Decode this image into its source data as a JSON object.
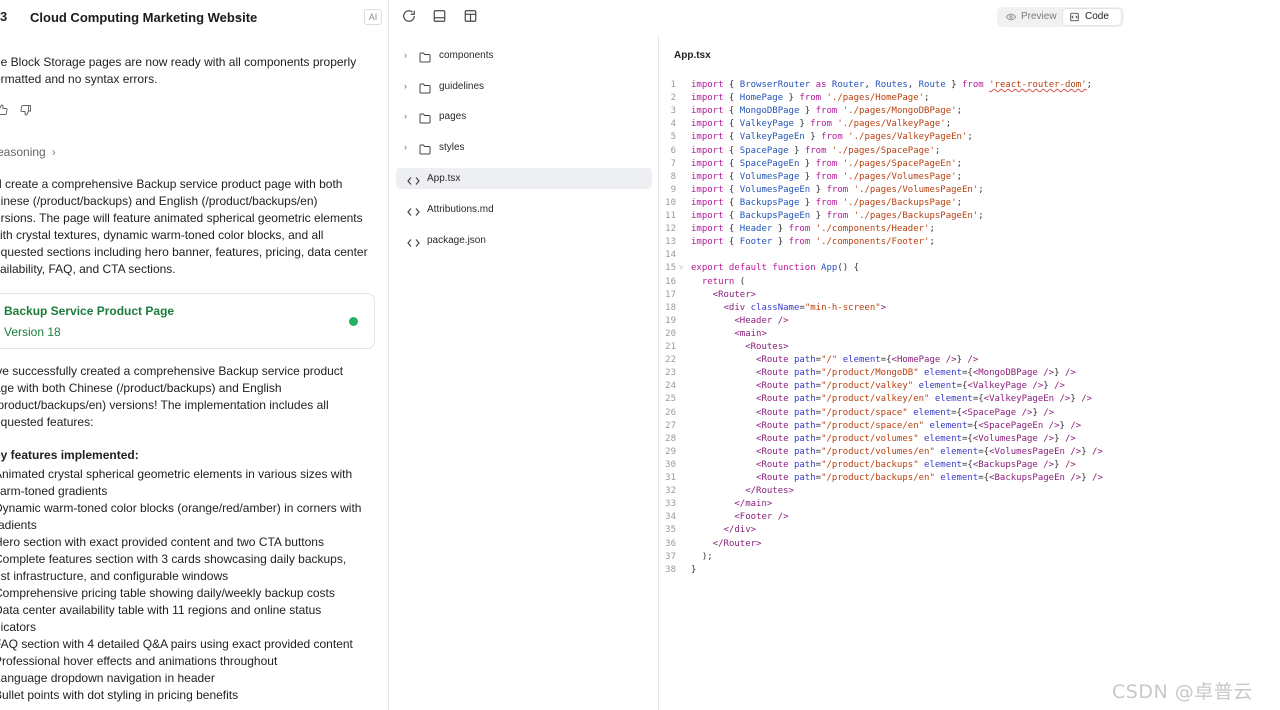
{
  "chat": {
    "logo_fragment": "3",
    "project_title": "Cloud Computing Marketing Website",
    "ai_badge": "AI",
    "intro_lines": [
      "he Block Storage pages are now ready with all components properly",
      "ormatted and no syntax errors."
    ],
    "reasoning_label": "easoning",
    "plan_lines": [
      "'ll create a comprehensive Backup service product page with both",
      "hinese (/product/backups) and English (/product/backups/en)",
      "ersions. The page will feature animated spherical geometric elements",
      "vith crystal textures, dynamic warm-toned color blocks, and all",
      "equested sections including hero banner, features, pricing, data center",
      "vailability, FAQ, and CTA sections."
    ],
    "version_card": {
      "title": "Backup Service Product Page",
      "version": "Version 18"
    },
    "summary_lines": [
      "'ve successfully created a comprehensive Backup service product",
      "age with both Chinese (/product/backups) and English",
      "/product/backups/en) versions! The implementation includes all",
      "equested features:"
    ],
    "key_features_heading": "ey features implemented:",
    "feature_lines": [
      " Animated crystal spherical geometric elements in various sizes with",
      "varm-toned gradients",
      " Dynamic warm-toned color blocks (orange/red/amber) in corners with",
      "radients",
      " Hero section with exact provided content and two CTA buttons",
      " Complete features section with 3 cards showcasing daily backups,",
      "ust infrastructure, and configurable windows",
      " Comprehensive pricing table showing daily/weekly backup costs",
      " Data center availability table with 11 regions and online status",
      "dicators",
      " FAQ section with 4 detailed Q&A pairs using exact provided content",
      " Professional hover effects and animations throughout",
      " Language dropdown navigation in header",
      " Bullet points with dot styling in pricing benefits"
    ]
  },
  "toolbar": {
    "preview_label": "Preview",
    "code_label": "Code",
    "active_view": "Code"
  },
  "file_tree": [
    {
      "type": "folder",
      "name": "components"
    },
    {
      "type": "folder",
      "name": "guidelines"
    },
    {
      "type": "folder",
      "name": "pages"
    },
    {
      "type": "folder",
      "name": "styles"
    },
    {
      "type": "file",
      "name": "App.tsx",
      "selected": true
    },
    {
      "type": "file",
      "name": "Attributions.md"
    },
    {
      "type": "file",
      "name": "package.json"
    }
  ],
  "editor": {
    "filename": "App.tsx",
    "lines": [
      [
        [
          "kw",
          "import"
        ],
        [
          "pl",
          " { "
        ],
        [
          "id",
          "BrowserRouter"
        ],
        [
          "kw",
          " as "
        ],
        [
          "id",
          "Router"
        ],
        [
          "pl",
          ", "
        ],
        [
          "id",
          "Routes"
        ],
        [
          "pl",
          ", "
        ],
        [
          "id",
          "Route"
        ],
        [
          "pl",
          " } "
        ],
        [
          "kw",
          "from"
        ],
        [
          "pl",
          " "
        ],
        [
          "stw",
          "'react-router-dom'"
        ],
        [
          "pl",
          ";"
        ]
      ],
      [
        [
          "kw",
          "import"
        ],
        [
          "pl",
          " { "
        ],
        [
          "id",
          "HomePage"
        ],
        [
          "pl",
          " } "
        ],
        [
          "kw",
          "from"
        ],
        [
          "st",
          " './pages/HomePage'"
        ],
        [
          "pl",
          ";"
        ]
      ],
      [
        [
          "kw",
          "import"
        ],
        [
          "pl",
          " { "
        ],
        [
          "id",
          "MongoDBPage"
        ],
        [
          "pl",
          " } "
        ],
        [
          "kw",
          "from"
        ],
        [
          "st",
          " './pages/MongoDBPage'"
        ],
        [
          "pl",
          ";"
        ]
      ],
      [
        [
          "kw",
          "import"
        ],
        [
          "pl",
          " { "
        ],
        [
          "id",
          "ValkeyPage"
        ],
        [
          "pl",
          " } "
        ],
        [
          "kw",
          "from"
        ],
        [
          "st",
          " './pages/ValkeyPage'"
        ],
        [
          "pl",
          ";"
        ]
      ],
      [
        [
          "kw",
          "import"
        ],
        [
          "pl",
          " { "
        ],
        [
          "id",
          "ValkeyPageEn"
        ],
        [
          "pl",
          " } "
        ],
        [
          "kw",
          "from"
        ],
        [
          "st",
          " './pages/ValkeyPageEn'"
        ],
        [
          "pl",
          ";"
        ]
      ],
      [
        [
          "kw",
          "import"
        ],
        [
          "pl",
          " { "
        ],
        [
          "id",
          "SpacePage"
        ],
        [
          "pl",
          " } "
        ],
        [
          "kw",
          "from"
        ],
        [
          "st",
          " './pages/SpacePage'"
        ],
        [
          "pl",
          ";"
        ]
      ],
      [
        [
          "kw",
          "import"
        ],
        [
          "pl",
          " { "
        ],
        [
          "id",
          "SpacePageEn"
        ],
        [
          "pl",
          " } "
        ],
        [
          "kw",
          "from"
        ],
        [
          "st",
          " './pages/SpacePageEn'"
        ],
        [
          "pl",
          ";"
        ]
      ],
      [
        [
          "kw",
          "import"
        ],
        [
          "pl",
          " { "
        ],
        [
          "id",
          "VolumesPage"
        ],
        [
          "pl",
          " } "
        ],
        [
          "kw",
          "from"
        ],
        [
          "st",
          " './pages/VolumesPage'"
        ],
        [
          "pl",
          ";"
        ]
      ],
      [
        [
          "kw",
          "import"
        ],
        [
          "pl",
          " { "
        ],
        [
          "id",
          "VolumesPageEn"
        ],
        [
          "pl",
          " } "
        ],
        [
          "kw",
          "from"
        ],
        [
          "st",
          " './pages/VolumesPageEn'"
        ],
        [
          "pl",
          ";"
        ]
      ],
      [
        [
          "kw",
          "import"
        ],
        [
          "pl",
          " { "
        ],
        [
          "id",
          "BackupsPage"
        ],
        [
          "pl",
          " } "
        ],
        [
          "kw",
          "from"
        ],
        [
          "st",
          " './pages/BackupsPage'"
        ],
        [
          "pl",
          ";"
        ]
      ],
      [
        [
          "kw",
          "import"
        ],
        [
          "pl",
          " { "
        ],
        [
          "id",
          "BackupsPageEn"
        ],
        [
          "pl",
          " } "
        ],
        [
          "kw",
          "from"
        ],
        [
          "st",
          " './pages/BackupsPageEn'"
        ],
        [
          "pl",
          ";"
        ]
      ],
      [
        [
          "kw",
          "import"
        ],
        [
          "pl",
          " { "
        ],
        [
          "id",
          "Header"
        ],
        [
          "pl",
          " } "
        ],
        [
          "kw",
          "from"
        ],
        [
          "st",
          " './components/Header'"
        ],
        [
          "pl",
          ";"
        ]
      ],
      [
        [
          "kw",
          "import"
        ],
        [
          "pl",
          " { "
        ],
        [
          "id",
          "Footer"
        ],
        [
          "pl",
          " } "
        ],
        [
          "kw",
          "from"
        ],
        [
          "st",
          " './components/Footer'"
        ],
        [
          "pl",
          ";"
        ]
      ],
      [],
      [
        [
          "kw",
          "export default function"
        ],
        [
          "pl",
          " "
        ],
        [
          "id",
          "App"
        ],
        [
          "pl",
          "() {"
        ]
      ],
      [
        [
          "pl",
          "  "
        ],
        [
          "kw",
          "return"
        ],
        [
          "pl",
          " ("
        ]
      ],
      [
        [
          "pl",
          "    "
        ],
        [
          "tg",
          "<Router>"
        ]
      ],
      [
        [
          "pl",
          "      "
        ],
        [
          "tg",
          "<div"
        ],
        [
          "pl",
          " "
        ],
        [
          "at",
          "className"
        ],
        [
          "pl",
          "="
        ],
        [
          "st",
          "\"min-h-screen\""
        ],
        [
          "tg",
          ">"
        ]
      ],
      [
        [
          "pl",
          "        "
        ],
        [
          "tg",
          "<Header />"
        ]
      ],
      [
        [
          "pl",
          "        "
        ],
        [
          "tg",
          "<main>"
        ]
      ],
      [
        [
          "pl",
          "          "
        ],
        [
          "tg",
          "<Routes>"
        ]
      ],
      [
        [
          "pl",
          "            "
        ],
        [
          "tg",
          "<Route"
        ],
        [
          "pl",
          " "
        ],
        [
          "at",
          "path"
        ],
        [
          "pl",
          "="
        ],
        [
          "st",
          "\"/\""
        ],
        [
          "pl",
          " "
        ],
        [
          "at",
          "element"
        ],
        [
          "pl",
          "={"
        ],
        [
          "tg",
          "<HomePage />"
        ],
        [
          "pl",
          "} "
        ],
        [
          "tg",
          "/>"
        ]
      ],
      [
        [
          "pl",
          "            "
        ],
        [
          "tg",
          "<Route"
        ],
        [
          "pl",
          " "
        ],
        [
          "at",
          "path"
        ],
        [
          "pl",
          "="
        ],
        [
          "st",
          "\"/product/MongoDB\""
        ],
        [
          "pl",
          " "
        ],
        [
          "at",
          "element"
        ],
        [
          "pl",
          "={"
        ],
        [
          "tg",
          "<MongoDBPage />"
        ],
        [
          "pl",
          "} "
        ],
        [
          "tg",
          "/>"
        ]
      ],
      [
        [
          "pl",
          "            "
        ],
        [
          "tg",
          "<Route"
        ],
        [
          "pl",
          " "
        ],
        [
          "at",
          "path"
        ],
        [
          "pl",
          "="
        ],
        [
          "st",
          "\"/product/valkey\""
        ],
        [
          "pl",
          " "
        ],
        [
          "at",
          "element"
        ],
        [
          "pl",
          "={"
        ],
        [
          "tg",
          "<ValkeyPage />"
        ],
        [
          "pl",
          "} "
        ],
        [
          "tg",
          "/>"
        ]
      ],
      [
        [
          "pl",
          "            "
        ],
        [
          "tg",
          "<Route"
        ],
        [
          "pl",
          " "
        ],
        [
          "at",
          "path"
        ],
        [
          "pl",
          "="
        ],
        [
          "st",
          "\"/product/valkey/en\""
        ],
        [
          "pl",
          " "
        ],
        [
          "at",
          "element"
        ],
        [
          "pl",
          "={"
        ],
        [
          "tg",
          "<ValkeyPageEn />"
        ],
        [
          "pl",
          "} "
        ],
        [
          "tg",
          "/>"
        ]
      ],
      [
        [
          "pl",
          "            "
        ],
        [
          "tg",
          "<Route"
        ],
        [
          "pl",
          " "
        ],
        [
          "at",
          "path"
        ],
        [
          "pl",
          "="
        ],
        [
          "st",
          "\"/product/space\""
        ],
        [
          "pl",
          " "
        ],
        [
          "at",
          "element"
        ],
        [
          "pl",
          "={"
        ],
        [
          "tg",
          "<SpacePage />"
        ],
        [
          "pl",
          "} "
        ],
        [
          "tg",
          "/>"
        ]
      ],
      [
        [
          "pl",
          "            "
        ],
        [
          "tg",
          "<Route"
        ],
        [
          "pl",
          " "
        ],
        [
          "at",
          "path"
        ],
        [
          "pl",
          "="
        ],
        [
          "st",
          "\"/product/space/en\""
        ],
        [
          "pl",
          " "
        ],
        [
          "at",
          "element"
        ],
        [
          "pl",
          "={"
        ],
        [
          "tg",
          "<SpacePageEn />"
        ],
        [
          "pl",
          "} "
        ],
        [
          "tg",
          "/>"
        ]
      ],
      [
        [
          "pl",
          "            "
        ],
        [
          "tg",
          "<Route"
        ],
        [
          "pl",
          " "
        ],
        [
          "at",
          "path"
        ],
        [
          "pl",
          "="
        ],
        [
          "st",
          "\"/product/volumes\""
        ],
        [
          "pl",
          " "
        ],
        [
          "at",
          "element"
        ],
        [
          "pl",
          "={"
        ],
        [
          "tg",
          "<VolumesPage />"
        ],
        [
          "pl",
          "} "
        ],
        [
          "tg",
          "/>"
        ]
      ],
      [
        [
          "pl",
          "            "
        ],
        [
          "tg",
          "<Route"
        ],
        [
          "pl",
          " "
        ],
        [
          "at",
          "path"
        ],
        [
          "pl",
          "="
        ],
        [
          "st",
          "\"/product/volumes/en\""
        ],
        [
          "pl",
          " "
        ],
        [
          "at",
          "element"
        ],
        [
          "pl",
          "={"
        ],
        [
          "tg",
          "<VolumesPageEn />"
        ],
        [
          "pl",
          "} "
        ],
        [
          "tg",
          "/>"
        ]
      ],
      [
        [
          "pl",
          "            "
        ],
        [
          "tg",
          "<Route"
        ],
        [
          "pl",
          " "
        ],
        [
          "at",
          "path"
        ],
        [
          "pl",
          "="
        ],
        [
          "st",
          "\"/product/backups\""
        ],
        [
          "pl",
          " "
        ],
        [
          "at",
          "element"
        ],
        [
          "pl",
          "={"
        ],
        [
          "tg",
          "<BackupsPage />"
        ],
        [
          "pl",
          "} "
        ],
        [
          "tg",
          "/>"
        ]
      ],
      [
        [
          "pl",
          "            "
        ],
        [
          "tg",
          "<Route"
        ],
        [
          "pl",
          " "
        ],
        [
          "at",
          "path"
        ],
        [
          "pl",
          "="
        ],
        [
          "st",
          "\"/product/backups/en\""
        ],
        [
          "pl",
          " "
        ],
        [
          "at",
          "element"
        ],
        [
          "pl",
          "={"
        ],
        [
          "tg",
          "<BackupsPageEn />"
        ],
        [
          "pl",
          "} "
        ],
        [
          "tg",
          "/>"
        ]
      ],
      [
        [
          "pl",
          "          "
        ],
        [
          "tg",
          "</Routes>"
        ]
      ],
      [
        [
          "pl",
          "        "
        ],
        [
          "tg",
          "</main>"
        ]
      ],
      [
        [
          "pl",
          "        "
        ],
        [
          "tg",
          "<Footer />"
        ]
      ],
      [
        [
          "pl",
          "      "
        ],
        [
          "tg",
          "</div>"
        ]
      ],
      [
        [
          "pl",
          "    "
        ],
        [
          "tg",
          "</Router>"
        ]
      ],
      [
        [
          "pl",
          "  );"
        ]
      ],
      [
        [
          "pl",
          "}"
        ]
      ]
    ]
  },
  "watermark": "CSDN @卓普云"
}
